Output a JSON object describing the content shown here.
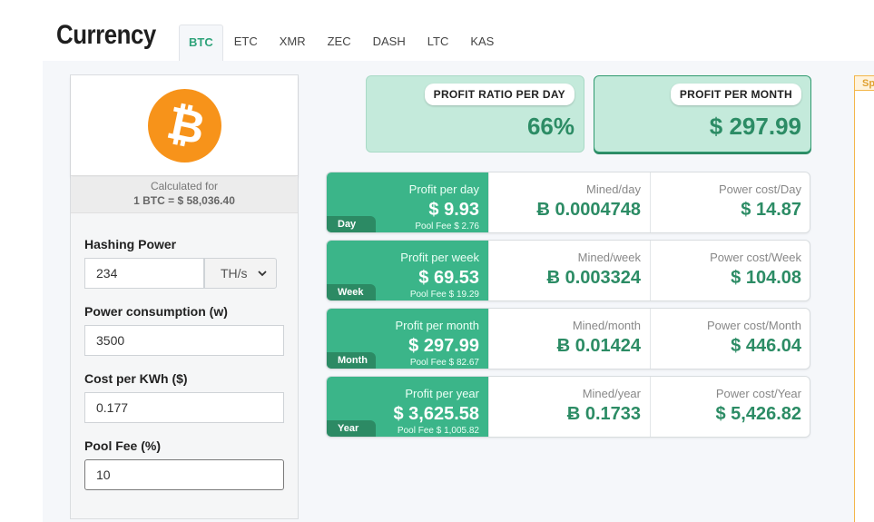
{
  "header": {
    "title": "Currency",
    "tabs": [
      {
        "label": "BTC",
        "active": true
      },
      {
        "label": "ETC",
        "active": false
      },
      {
        "label": "XMR",
        "active": false
      },
      {
        "label": "ZEC",
        "active": false
      },
      {
        "label": "DASH",
        "active": false
      },
      {
        "label": "LTC",
        "active": false
      },
      {
        "label": "KAS",
        "active": false
      }
    ]
  },
  "coin": {
    "icon": "bitcoin-icon",
    "symbol": "₿",
    "color": "#f7931a",
    "calculated_for": "Calculated for",
    "rate": "1 BTC = $ 58,036.40"
  },
  "form": {
    "hashing_power": {
      "label": "Hashing Power",
      "value": "234",
      "unit": "TH/s"
    },
    "power_consumption": {
      "label": "Power consumption (w)",
      "value": "3500"
    },
    "cost_per_kwh": {
      "label": "Cost per KWh ($)",
      "value": "0.177"
    },
    "pool_fee": {
      "label": "Pool Fee (%)",
      "value": "10"
    }
  },
  "summary": {
    "ratio": {
      "label": "PROFIT RATIO PER DAY",
      "value": "66%"
    },
    "month": {
      "label": "PROFIT PER MONTH",
      "value": "$ 297.99"
    }
  },
  "rows": [
    {
      "tag": "Day",
      "profit_label": "Profit per day",
      "profit": "$ 9.93",
      "pool_fee": "Pool Fee $ 2.76",
      "mined_label": "Mined/day",
      "mined": "Ƀ 0.0004748",
      "power_label": "Power cost/Day",
      "power": "$ 14.87"
    },
    {
      "tag": "Week",
      "profit_label": "Profit per week",
      "profit": "$ 69.53",
      "pool_fee": "Pool Fee $ 19.29",
      "mined_label": "Mined/week",
      "mined": "Ƀ 0.003324",
      "power_label": "Power cost/Week",
      "power": "$ 104.08"
    },
    {
      "tag": "Month",
      "profit_label": "Profit per month",
      "profit": "$ 297.99",
      "pool_fee": "Pool Fee $ 82.67",
      "mined_label": "Mined/month",
      "mined": "Ƀ 0.01424",
      "power_label": "Power cost/Month",
      "power": "$ 446.04"
    },
    {
      "tag": "Year",
      "profit_label": "Profit per year",
      "profit": "$ 3,625.58",
      "pool_fee": "Pool Fee $ 1,005.82",
      "mined_label": "Mined/year",
      "mined": "Ƀ 0.1733",
      "power_label": "Power cost/Year",
      "power": "$ 5,426.82"
    }
  ],
  "sidebar_right": {
    "tag": "Sp"
  },
  "colors": {
    "accent": "#3bb589",
    "accent_dark": "#2c8a64",
    "summary_bg": "#c4eadb",
    "bitcoin": "#f7931a"
  }
}
